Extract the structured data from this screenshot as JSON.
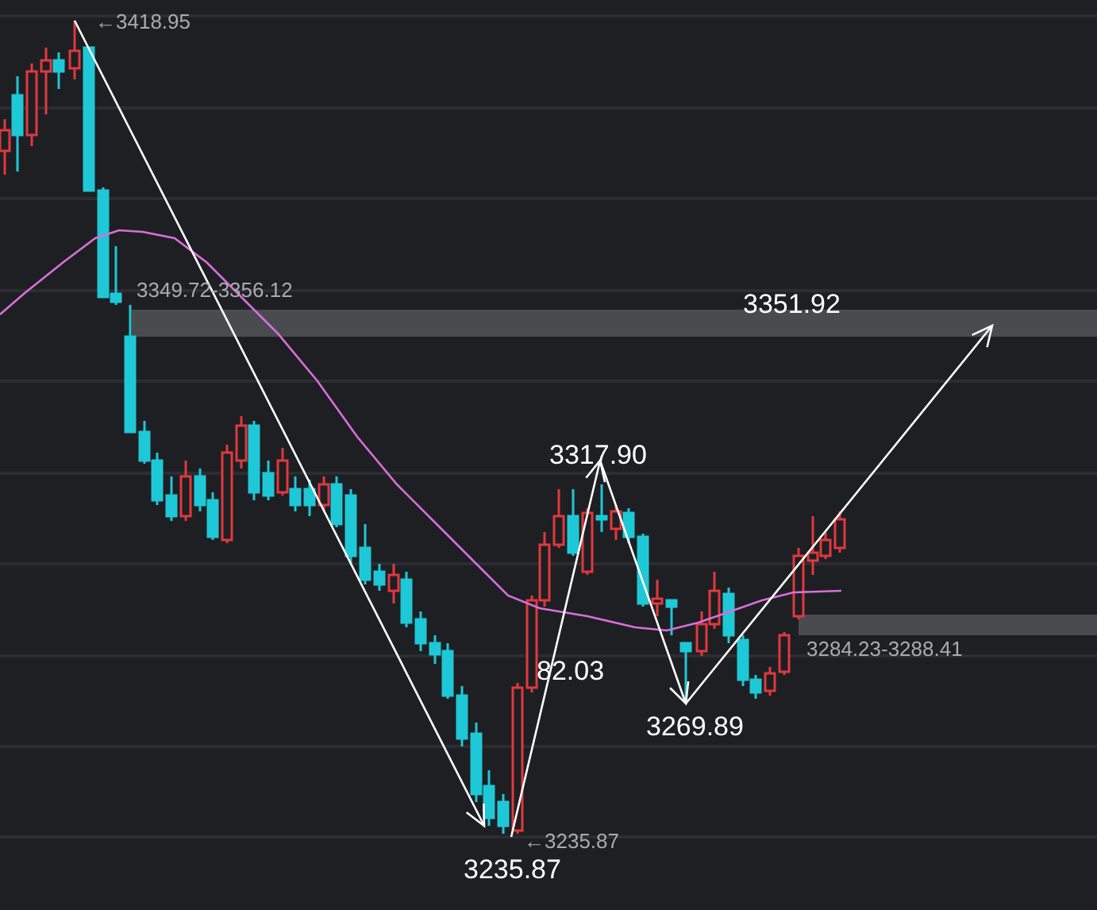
{
  "labels": [
    {
      "kind": "minor",
      "text": "←3418.95"
    },
    {
      "kind": "minor",
      "text": "3349.72-3356.12"
    },
    {
      "kind": "major",
      "text": "3351.92"
    },
    {
      "kind": "major",
      "text": "3317.90"
    },
    {
      "kind": "major",
      "text": "82.03"
    },
    {
      "kind": "major",
      "text": "3269.89"
    },
    {
      "kind": "minor",
      "text": "3284.23-3288.41"
    },
    {
      "kind": "minor",
      "text": "←3235.87"
    },
    {
      "kind": "major",
      "text": "3235.87"
    }
  ]
}
